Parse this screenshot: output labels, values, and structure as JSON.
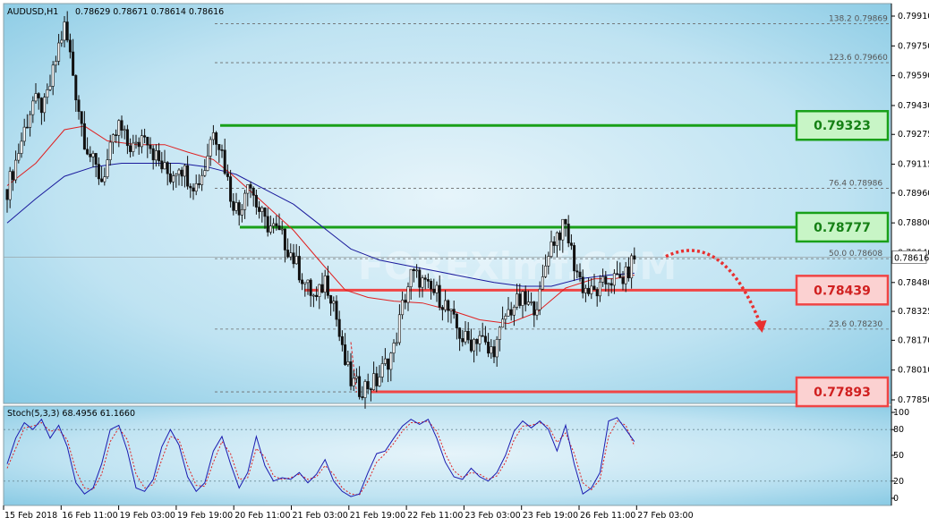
{
  "header": {
    "symbol": "AUDUSD,H1",
    "ohlc": "0.78629 0.78671 0.78614 0.78616",
    "stoch_label": "Stoch(5,3,3) 68.4956 61.1660"
  },
  "watermark": "FOREXimf.COM",
  "colors": {
    "bg_light": "#e6f4fa",
    "bg_dark": "#79c3e0",
    "bull": "#ffffff",
    "bear": "#111111",
    "ma_fast": "#e02020",
    "ma_slow": "#1a1a9c",
    "resistance": "#19a019",
    "support": "#f04545",
    "resistance_box": "#c8f5c6",
    "support_box": "#fbd1d1",
    "stoch_main": "#1b1bb0",
    "stoch_signal": "#e02020",
    "arrow": "#e83030"
  },
  "chart_data": [
    {
      "type": "candlestick",
      "title": "AUDUSD,H1",
      "y_ticks": [
        "0.79910",
        "0.79750",
        "0.79590",
        "0.79430",
        "0.79275",
        "0.79115",
        "0.78960",
        "0.78800",
        "0.78640",
        "0.78480",
        "0.78325",
        "0.78170",
        "0.78010",
        "0.77850"
      ],
      "y_range": [
        0.7778,
        0.7998
      ],
      "x_labels": [
        "15 Feb 2018",
        "16 Feb 11:00",
        "19 Feb 03:00",
        "19 Feb 19:00",
        "20 Feb 11:00",
        "21 Feb 03:00",
        "21 Feb 19:00",
        "22 Feb 11:00",
        "23 Feb 03:00",
        "23 Feb 19:00",
        "26 Feb 11:00",
        "27 Feb 03:00"
      ],
      "current_price": "0.78616",
      "fib_levels": [
        {
          "label": "138.2",
          "value": "0.79869"
        },
        {
          "label": "123.6",
          "value": "0.79660"
        },
        {
          "label": "76.4",
          "value": "0.78986"
        },
        {
          "label": "50.0",
          "value": "0.78608"
        },
        {
          "label": "23.6",
          "value": "0.78230"
        }
      ],
      "key_levels": [
        {
          "value": "0.79323",
          "kind": "resistance"
        },
        {
          "value": "0.78777",
          "kind": "resistance"
        },
        {
          "value": "0.78439",
          "kind": "support"
        },
        {
          "value": "0.77893",
          "kind": "support"
        }
      ],
      "price_path": [
        [
          0,
          0.7898
        ],
        [
          3,
          0.7913
        ],
        [
          6,
          0.793
        ],
        [
          9,
          0.7945
        ],
        [
          13,
          0.7942
        ],
        [
          16,
          0.796
        ],
        [
          18,
          0.7975
        ],
        [
          20,
          0.7985
        ],
        [
          22,
          0.797
        ],
        [
          24,
          0.795
        ],
        [
          27,
          0.7925
        ],
        [
          30,
          0.7912
        ],
        [
          33,
          0.7903
        ],
        [
          36,
          0.7918
        ],
        [
          39,
          0.7932
        ],
        [
          42,
          0.7922
        ],
        [
          45,
          0.792
        ],
        [
          48,
          0.793
        ],
        [
          51,
          0.7918
        ],
        [
          54,
          0.791
        ],
        [
          57,
          0.7905
        ],
        [
          60,
          0.7912
        ],
        [
          63,
          0.7905
        ],
        [
          66,
          0.79
        ],
        [
          69,
          0.791
        ],
        [
          72,
          0.7932
        ],
        [
          75,
          0.7918
        ],
        [
          78,
          0.7895
        ],
        [
          81,
          0.7885
        ],
        [
          84,
          0.7905
        ],
        [
          87,
          0.789
        ],
        [
          90,
          0.788
        ],
        [
          93,
          0.7877
        ],
        [
          96,
          0.7872
        ],
        [
          99,
          0.7864
        ],
        [
          102,
          0.7854
        ],
        [
          105,
          0.7845
        ],
        [
          108,
          0.7838
        ],
        [
          111,
          0.785
        ],
        [
          114,
          0.7838
        ],
        [
          117,
          0.781
        ],
        [
          120,
          0.7795
        ],
        [
          123,
          0.7791
        ],
        [
          126,
          0.7793
        ],
        [
          129,
          0.7795
        ],
        [
          132,
          0.7804
        ],
        [
          135,
          0.7812
        ],
        [
          138,
          0.7835
        ],
        [
          141,
          0.7852
        ],
        [
          144,
          0.785
        ],
        [
          147,
          0.7844
        ],
        [
          150,
          0.7842
        ],
        [
          153,
          0.7836
        ],
        [
          156,
          0.7826
        ],
        [
          159,
          0.7818
        ],
        [
          162,
          0.7816
        ],
        [
          165,
          0.782
        ],
        [
          168,
          0.781
        ],
        [
          171,
          0.7815
        ],
        [
          174,
          0.783
        ],
        [
          177,
          0.7836
        ],
        [
          180,
          0.7838
        ],
        [
          183,
          0.7834
        ],
        [
          186,
          0.784
        ],
        [
          189,
          0.7866
        ],
        [
          192,
          0.7874
        ],
        [
          195,
          0.7878
        ],
        [
          198,
          0.7858
        ],
        [
          201,
          0.7846
        ],
        [
          204,
          0.7842
        ],
        [
          207,
          0.7844
        ],
        [
          210,
          0.785
        ],
        [
          213,
          0.7849
        ],
        [
          216,
          0.7851
        ],
        [
          219,
          0.7862
        ]
      ],
      "ma_fast_path": [
        [
          0,
          0.79
        ],
        [
          10,
          0.7912
        ],
        [
          20,
          0.793
        ],
        [
          27,
          0.7932
        ],
        [
          35,
          0.7924
        ],
        [
          45,
          0.7922
        ],
        [
          55,
          0.7922
        ],
        [
          63,
          0.7918
        ],
        [
          72,
          0.7914
        ],
        [
          80,
          0.7904
        ],
        [
          90,
          0.789
        ],
        [
          100,
          0.7876
        ],
        [
          110,
          0.7858
        ],
        [
          118,
          0.7844
        ],
        [
          126,
          0.784
        ],
        [
          135,
          0.7838
        ],
        [
          145,
          0.7837
        ],
        [
          155,
          0.7833
        ],
        [
          165,
          0.7828
        ],
        [
          175,
          0.7826
        ],
        [
          185,
          0.7832
        ],
        [
          195,
          0.7845
        ],
        [
          205,
          0.785
        ],
        [
          212,
          0.785
        ],
        [
          219,
          0.7852
        ]
      ],
      "ma_slow_path": [
        [
          0,
          0.788
        ],
        [
          10,
          0.7893
        ],
        [
          20,
          0.7905
        ],
        [
          30,
          0.791
        ],
        [
          40,
          0.7912
        ],
        [
          50,
          0.7912
        ],
        [
          60,
          0.7912
        ],
        [
          70,
          0.791
        ],
        [
          80,
          0.7906
        ],
        [
          90,
          0.7898
        ],
        [
          100,
          0.789
        ],
        [
          110,
          0.7878
        ],
        [
          120,
          0.7866
        ],
        [
          130,
          0.786
        ],
        [
          140,
          0.7857
        ],
        [
          150,
          0.7854
        ],
        [
          160,
          0.7851
        ],
        [
          170,
          0.7848
        ],
        [
          180,
          0.7846
        ],
        [
          190,
          0.7846
        ],
        [
          200,
          0.785
        ],
        [
          210,
          0.7852
        ],
        [
          219,
          0.7853
        ]
      ],
      "dashed_path": [
        [
          120,
          0.7816
        ],
        [
          122,
          0.7789
        ]
      ],
      "projection": {
        "from": [
          230,
          0.7862
        ],
        "to": [
          263,
          0.7822
        ]
      }
    },
    {
      "type": "line",
      "title": "Stoch(5,3,3) 68.4956 61.1660",
      "y_ticks": [
        "100",
        "80",
        "50",
        "20",
        "0"
      ],
      "y_range": [
        0,
        100
      ],
      "levels": [
        80,
        20
      ],
      "series": [
        {
          "name": "main",
          "values": [
            [
              0,
              40
            ],
            [
              3,
              70
            ],
            [
              6,
              88
            ],
            [
              9,
              80
            ],
            [
              12,
              92
            ],
            [
              15,
              70
            ],
            [
              18,
              85
            ],
            [
              21,
              60
            ],
            [
              24,
              18
            ],
            [
              27,
              5
            ],
            [
              30,
              12
            ],
            [
              33,
              40
            ],
            [
              36,
              80
            ],
            [
              39,
              85
            ],
            [
              42,
              55
            ],
            [
              45,
              12
            ],
            [
              48,
              8
            ],
            [
              51,
              22
            ],
            [
              54,
              60
            ],
            [
              57,
              80
            ],
            [
              60,
              62
            ],
            [
              63,
              25
            ],
            [
              66,
              8
            ],
            [
              69,
              18
            ],
            [
              72,
              55
            ],
            [
              75,
              72
            ],
            [
              78,
              40
            ],
            [
              81,
              12
            ],
            [
              84,
              30
            ],
            [
              87,
              72
            ],
            [
              90,
              38
            ],
            [
              93,
              20
            ],
            [
              96,
              24
            ],
            [
              99,
              22
            ],
            [
              102,
              30
            ],
            [
              105,
              18
            ],
            [
              108,
              28
            ],
            [
              111,
              45
            ],
            [
              114,
              20
            ],
            [
              117,
              8
            ],
            [
              120,
              2
            ],
            [
              123,
              5
            ],
            [
              126,
              30
            ],
            [
              129,
              52
            ],
            [
              132,
              55
            ],
            [
              135,
              70
            ],
            [
              138,
              84
            ],
            [
              141,
              92
            ],
            [
              144,
              86
            ],
            [
              147,
              92
            ],
            [
              150,
              70
            ],
            [
              153,
              42
            ],
            [
              156,
              25
            ],
            [
              159,
              22
            ],
            [
              162,
              35
            ],
            [
              165,
              25
            ],
            [
              168,
              20
            ],
            [
              171,
              30
            ],
            [
              174,
              50
            ],
            [
              177,
              78
            ],
            [
              180,
              90
            ],
            [
              183,
              82
            ],
            [
              186,
              90
            ],
            [
              189,
              80
            ],
            [
              192,
              55
            ],
            [
              195,
              85
            ],
            [
              198,
              40
            ],
            [
              201,
              5
            ],
            [
              204,
              12
            ],
            [
              207,
              30
            ],
            [
              210,
              90
            ],
            [
              213,
              94
            ],
            [
              216,
              80
            ],
            [
              219,
              66
            ]
          ]
        },
        {
          "name": "signal",
          "values": [
            [
              0,
              35
            ],
            [
              3,
              58
            ],
            [
              6,
              82
            ],
            [
              9,
              84
            ],
            [
              12,
              88
            ],
            [
              15,
              78
            ],
            [
              18,
              80
            ],
            [
              21,
              68
            ],
            [
              24,
              32
            ],
            [
              27,
              12
            ],
            [
              30,
              10
            ],
            [
              33,
              28
            ],
            [
              36,
              66
            ],
            [
              39,
              82
            ],
            [
              42,
              68
            ],
            [
              45,
              28
            ],
            [
              48,
              12
            ],
            [
              51,
              16
            ],
            [
              54,
              45
            ],
            [
              57,
              72
            ],
            [
              60,
              68
            ],
            [
              63,
              38
            ],
            [
              66,
              15
            ],
            [
              69,
              14
            ],
            [
              72,
              42
            ],
            [
              75,
              66
            ],
            [
              78,
              52
            ],
            [
              81,
              22
            ],
            [
              84,
              24
            ],
            [
              87,
              58
            ],
            [
              90,
              48
            ],
            [
              93,
              26
            ],
            [
              96,
              22
            ],
            [
              99,
              24
            ],
            [
              102,
              28
            ],
            [
              105,
              22
            ],
            [
              108,
              25
            ],
            [
              111,
              38
            ],
            [
              114,
              28
            ],
            [
              117,
              12
            ],
            [
              120,
              5
            ],
            [
              123,
              4
            ],
            [
              126,
              20
            ],
            [
              129,
              42
            ],
            [
              132,
              52
            ],
            [
              135,
              64
            ],
            [
              138,
              78
            ],
            [
              141,
              88
            ],
            [
              144,
              88
            ],
            [
              147,
              90
            ],
            [
              150,
              78
            ],
            [
              153,
              52
            ],
            [
              156,
              32
            ],
            [
              159,
              24
            ],
            [
              162,
              30
            ],
            [
              165,
              28
            ],
            [
              168,
              22
            ],
            [
              171,
              26
            ],
            [
              174,
              42
            ],
            [
              177,
              68
            ],
            [
              180,
              84
            ],
            [
              183,
              85
            ],
            [
              186,
              88
            ],
            [
              189,
              84
            ],
            [
              192,
              65
            ],
            [
              195,
              76
            ],
            [
              198,
              52
            ],
            [
              201,
              18
            ],
            [
              204,
              10
            ],
            [
              207,
              22
            ],
            [
              210,
              72
            ],
            [
              213,
              90
            ],
            [
              216,
              85
            ],
            [
              219,
              61
            ]
          ]
        }
      ]
    }
  ]
}
